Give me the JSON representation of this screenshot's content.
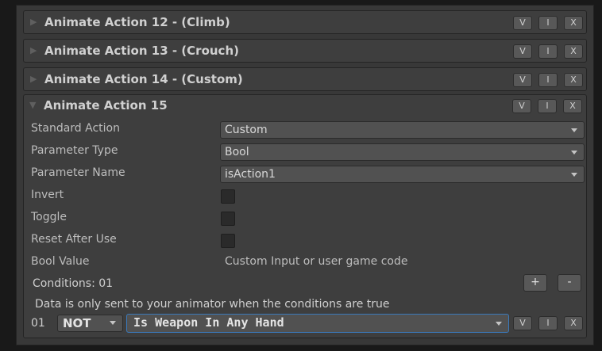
{
  "collapsed_actions": [
    {
      "title": "Animate Action 12 - (Climb)"
    },
    {
      "title": "Animate Action 13 - (Crouch)"
    },
    {
      "title": "Animate Action 14 - (Custom)"
    }
  ],
  "header_buttons": {
    "view": "V",
    "insert": "I",
    "delete": "X"
  },
  "expanded_action": {
    "title": "Animate Action 15",
    "standard_action": {
      "label": "Standard Action",
      "value": "Custom"
    },
    "parameter_type": {
      "label": "Parameter Type",
      "value": "Bool"
    },
    "parameter_name": {
      "label": "Parameter Name",
      "value": "isAction1"
    },
    "invert": {
      "label": "Invert",
      "checked": false
    },
    "toggle": {
      "label": "Toggle",
      "checked": false
    },
    "reset_after_use": {
      "label": "Reset After Use",
      "checked": false
    },
    "bool_value": {
      "label": "Bool Value",
      "value": "Custom Input or user game code"
    },
    "conditions": {
      "label": "Conditions: 01",
      "add_label": "+",
      "remove_label": "-",
      "info": "Data is only sent to your animator when the conditions are true",
      "items": [
        {
          "index": "01",
          "operator": "NOT",
          "condition": "Is Weapon In Any Hand"
        }
      ]
    }
  },
  "colors": {
    "background": "#383838",
    "panel": "#3e3e3e",
    "focus": "#3a79bb"
  },
  "icons": {
    "collapsed": "triangle-right-icon",
    "expanded": "triangle-down-icon",
    "dropdown": "caret-down-icon"
  }
}
